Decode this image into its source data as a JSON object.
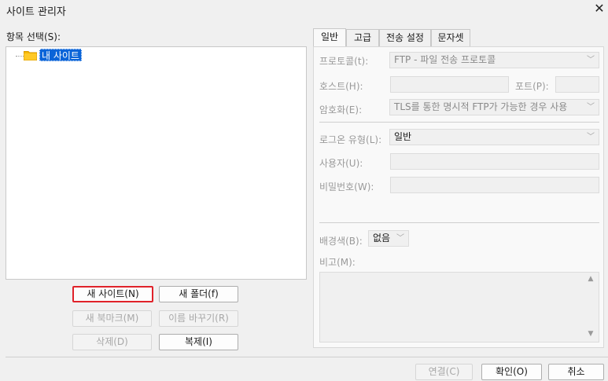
{
  "window": {
    "title": "사이트 관리자",
    "close_glyph": "✕"
  },
  "left": {
    "select_label": "항목 선택(S):",
    "tree": {
      "items": [
        {
          "label": "내 사이트",
          "selected": true,
          "icon": "folder-icon"
        }
      ]
    },
    "buttons": {
      "new_site": "새 사이트(N)",
      "new_folder": "새 폴더(f)",
      "new_bookmark": "새 북마크(M)",
      "rename": "이름 바꾸기(R)",
      "delete": "삭제(D)",
      "duplicate": "복제(I)"
    }
  },
  "tabs": [
    {
      "label": "일반",
      "active": true
    },
    {
      "label": "고급",
      "active": false
    },
    {
      "label": "전송 설정",
      "active": false
    },
    {
      "label": "문자셋",
      "active": false
    }
  ],
  "general": {
    "protocol_label": "프로토콜(t):",
    "protocol_value": "FTP - 파일 전송 프로토콜",
    "host_label": "호스트(H):",
    "host_value": "",
    "port_label": "포트(P):",
    "port_value": "",
    "encryption_label": "암호화(E):",
    "encryption_value": "TLS를 통한 명시적 FTP가 가능한 경우 사용",
    "logon_label": "로그온 유형(L):",
    "logon_value": "일반",
    "user_label": "사용자(U):",
    "user_value": "",
    "password_label": "비밀번호(W):",
    "password_value": "",
    "bg_label": "배경색(B):",
    "bg_value": "없음",
    "notes_label": "비고(M):",
    "notes_value": ""
  },
  "footer": {
    "connect": "연결(C)",
    "ok": "확인(O)",
    "cancel": "취소"
  },
  "icons": {
    "chevron": "﹀",
    "scroll_up": "▲",
    "scroll_down": "▼"
  },
  "colors": {
    "selection": "#0a64d8",
    "focus_border": "#e0222a",
    "folder": "#f5b800"
  }
}
